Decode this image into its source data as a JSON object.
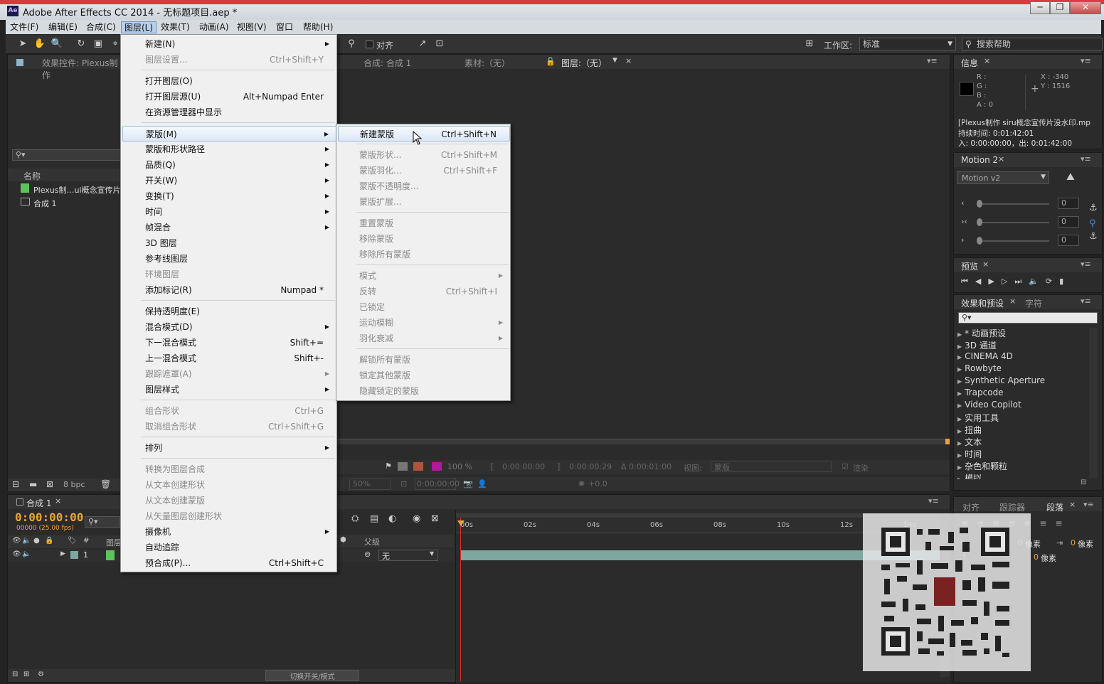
{
  "window": {
    "title": "Adobe After Effects CC 2014 - 无标题项目.aep *",
    "app_icon": "Ae",
    "controls": [
      "─",
      "❐",
      "✕"
    ]
  },
  "menubar": [
    "文件(F)",
    "编辑(E)",
    "合成(C)",
    "图层(L)",
    "效果(T)",
    "动画(A)",
    "视图(V)",
    "窗口",
    "帮助(H)"
  ],
  "toolbar": {
    "align_label": "对齐",
    "workspace_label": "工作区:",
    "workspace_value": "标准",
    "search_help": "搜索帮助"
  },
  "left_panel": {
    "tab": "效果控件: Plexus制作",
    "search_glyph": "⚲▾",
    "name_header": "名称",
    "items": [
      "Plexus制…ui概念宣传片",
      "合成 1"
    ],
    "bpc": "8 bpc"
  },
  "viewer": {
    "tab_comp": "合成: 合成 1",
    "tab_footage": "素材:（无）",
    "tab_layer": "图层:（无）",
    "zoom": "100 %",
    "time1": "0:00:00:00",
    "time2": "0:00:00:29",
    "delta": "Δ 0:00:01:00",
    "view_label": "视图:",
    "view_value": "蒙版",
    "render_label": "渲染",
    "res": "50%",
    "tc": "0:00:00:00",
    "offset": "+0.0"
  },
  "layer_menu": {
    "items": [
      {
        "label": "新建(N)",
        "shortcut": "",
        "submenu": true,
        "disabled": false
      },
      {
        "label": "图层设置...",
        "shortcut": "Ctrl+Shift+Y",
        "submenu": false,
        "disabled": true
      },
      {
        "sep": true
      },
      {
        "label": "打开图层(O)",
        "shortcut": "",
        "submenu": false,
        "disabled": false
      },
      {
        "label": "打开图层源(U)",
        "shortcut": "Alt+Numpad Enter",
        "submenu": false,
        "disabled": false
      },
      {
        "label": "在资源管理器中显示",
        "shortcut": "",
        "submenu": false,
        "disabled": false
      },
      {
        "sep": true
      },
      {
        "label": "蒙版(M)",
        "shortcut": "",
        "submenu": true,
        "disabled": false,
        "highlight": true
      },
      {
        "label": "蒙版和形状路径",
        "shortcut": "",
        "submenu": true,
        "disabled": false
      },
      {
        "label": "品质(Q)",
        "shortcut": "",
        "submenu": true,
        "disabled": false
      },
      {
        "label": "开关(W)",
        "shortcut": "",
        "submenu": true,
        "disabled": false
      },
      {
        "label": "变换(T)",
        "shortcut": "",
        "submenu": true,
        "disabled": false
      },
      {
        "label": "时间",
        "shortcut": "",
        "submenu": true,
        "disabled": false
      },
      {
        "label": "帧混合",
        "shortcut": "",
        "submenu": true,
        "disabled": false
      },
      {
        "label": "3D 图层",
        "shortcut": "",
        "submenu": false,
        "disabled": false
      },
      {
        "label": "参考线图层",
        "shortcut": "",
        "submenu": false,
        "disabled": false
      },
      {
        "label": "环境图层",
        "shortcut": "",
        "submenu": false,
        "disabled": true
      },
      {
        "label": "添加标记(R)",
        "shortcut": "Numpad *",
        "submenu": false,
        "disabled": false
      },
      {
        "sep": true
      },
      {
        "label": "保持透明度(E)",
        "shortcut": "",
        "submenu": false,
        "disabled": false
      },
      {
        "label": "混合模式(D)",
        "shortcut": "",
        "submenu": true,
        "disabled": false
      },
      {
        "label": "下一混合模式",
        "shortcut": "Shift+=",
        "submenu": false,
        "disabled": false
      },
      {
        "label": "上一混合模式",
        "shortcut": "Shift+-",
        "submenu": false,
        "disabled": false
      },
      {
        "label": "跟踪遮罩(A)",
        "shortcut": "",
        "submenu": true,
        "disabled": true
      },
      {
        "label": "图层样式",
        "shortcut": "",
        "submenu": true,
        "disabled": false
      },
      {
        "sep": true
      },
      {
        "label": "组合形状",
        "shortcut": "Ctrl+G",
        "submenu": false,
        "disabled": true
      },
      {
        "label": "取消组合形状",
        "shortcut": "Ctrl+Shift+G",
        "submenu": false,
        "disabled": true
      },
      {
        "sep": true
      },
      {
        "label": "排列",
        "shortcut": "",
        "submenu": true,
        "disabled": false
      },
      {
        "sep": true
      },
      {
        "label": "转换为图层合成",
        "shortcut": "",
        "submenu": false,
        "disabled": true
      },
      {
        "label": "从文本创建形状",
        "shortcut": "",
        "submenu": false,
        "disabled": true
      },
      {
        "label": "从文本创建蒙版",
        "shortcut": "",
        "submenu": false,
        "disabled": true
      },
      {
        "label": "从矢量图层创建形状",
        "shortcut": "",
        "submenu": false,
        "disabled": true
      },
      {
        "label": "摄像机",
        "shortcut": "",
        "submenu": true,
        "disabled": false
      },
      {
        "label": "自动追踪",
        "shortcut": "",
        "submenu": false,
        "disabled": false
      },
      {
        "label": "预合成(P)...",
        "shortcut": "Ctrl+Shift+C",
        "submenu": false,
        "disabled": false
      }
    ]
  },
  "mask_submenu": {
    "items": [
      {
        "label": "新建蒙版",
        "shortcut": "Ctrl+Shift+N",
        "submenu": false,
        "disabled": false,
        "highlight": true
      },
      {
        "sep": true
      },
      {
        "label": "蒙版形状...",
        "shortcut": "Ctrl+Shift+M",
        "submenu": false,
        "disabled": true
      },
      {
        "label": "蒙版羽化...",
        "shortcut": "Ctrl+Shift+F",
        "submenu": false,
        "disabled": true
      },
      {
        "label": "蒙版不透明度...",
        "shortcut": "",
        "submenu": false,
        "disabled": true
      },
      {
        "label": "蒙版扩展...",
        "shortcut": "",
        "submenu": false,
        "disabled": true
      },
      {
        "sep": true
      },
      {
        "label": "重置蒙版",
        "shortcut": "",
        "submenu": false,
        "disabled": true
      },
      {
        "label": "移除蒙版",
        "shortcut": "",
        "submenu": false,
        "disabled": true
      },
      {
        "label": "移除所有蒙版",
        "shortcut": "",
        "submenu": false,
        "disabled": true
      },
      {
        "sep": true
      },
      {
        "label": "模式",
        "shortcut": "",
        "submenu": true,
        "disabled": true
      },
      {
        "label": "反转",
        "shortcut": "Ctrl+Shift+I",
        "submenu": false,
        "disabled": true
      },
      {
        "label": "已锁定",
        "shortcut": "",
        "submenu": false,
        "disabled": true
      },
      {
        "label": "运动模糊",
        "shortcut": "",
        "submenu": true,
        "disabled": true
      },
      {
        "label": "羽化衰减",
        "shortcut": "",
        "submenu": true,
        "disabled": true
      },
      {
        "sep": true
      },
      {
        "label": "解锁所有蒙版",
        "shortcut": "",
        "submenu": false,
        "disabled": true
      },
      {
        "label": "锁定其他蒙版",
        "shortcut": "",
        "submenu": false,
        "disabled": true
      },
      {
        "label": "隐藏锁定的蒙版",
        "shortcut": "",
        "submenu": false,
        "disabled": true
      }
    ]
  },
  "info_panel": {
    "tab": "信息",
    "r": "R :",
    "g": "G :",
    "b": "B :",
    "a": "A : 0",
    "x": "X : -340",
    "y": "Y : 1516",
    "file": "[Plexus制作 siru概念宣传片没水印.mp",
    "duration": "持续时间: 0:01:42:01",
    "inout": "入: 0:00:00:00，出: 0:01:42:00"
  },
  "motion_panel": {
    "tab": "Motion 2",
    "select": "Motion v2",
    "values": [
      "0",
      "0",
      "0"
    ]
  },
  "preview_panel": {
    "tab": "预览"
  },
  "effects_panel": {
    "tab1": "效果和预设",
    "tab2": "字符",
    "search_glyph": "⚲▾",
    "items": [
      "* 动画预设",
      "3D 通道",
      "CINEMA 4D",
      "Rowbyte",
      "Synthetic Aperture",
      "Trapcode",
      "Video Copilot",
      "实用工具",
      "扭曲",
      "文本",
      "时间",
      "杂色和颗粒",
      "模拟"
    ]
  },
  "paragraph_panel": {
    "tabs": [
      "对齐",
      "跟踪器",
      "段落"
    ],
    "unit1": "像素",
    "unit2": "像素",
    "unit3": "像素",
    "val1": "0",
    "val2": "0",
    "val3": "0"
  },
  "timeline": {
    "tab": "合成 1",
    "timecode": "0:00:00:00",
    "fps": "00000 (25.00 fps)",
    "search_glyph": "⚲▾",
    "layer_col": "图层",
    "parent_col": "父级",
    "parent_value": "无",
    "layer_num": "1",
    "ruler": [
      "00s",
      "02s",
      "04s",
      "06s",
      "08s",
      "10s",
      "12s",
      "14s"
    ],
    "toggle_label": "切换开关/模式"
  },
  "colors": {
    "accent_orange": "#e8a531",
    "timeline_bar": "#7ea7a0",
    "playhead": "#d92b2b",
    "menu_highlight": "#dbe8f7"
  }
}
